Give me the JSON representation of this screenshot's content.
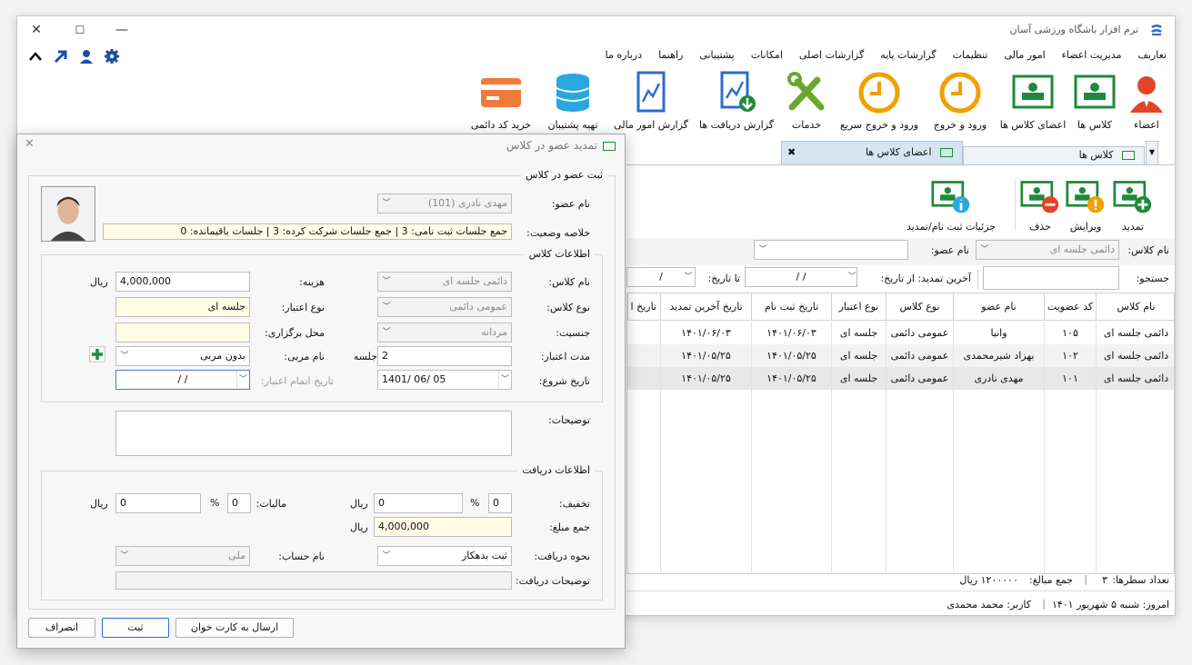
{
  "app": {
    "title": "نرم افزار باشگاه ورزشی آسان"
  },
  "window": {
    "minimize": "—",
    "maximize": "☐",
    "close": "✕"
  },
  "menu": [
    "تعاریف",
    "مدیریت اعضاء",
    "امور مالی",
    "تنظیمات",
    "گزارشات پایه",
    "گزارشات اصلی",
    "امکانات",
    "پشتیبانی",
    "راهنما",
    "درباره ما"
  ],
  "quick_icons": [
    "gear-icon",
    "user-icon",
    "arrow-up-right-icon",
    "chevron-up-icon"
  ],
  "ribbon": [
    "اعضاء",
    "کلاس ها",
    "اعضای کلاس ها",
    "ورود و خروج",
    "ورود و خروج سریع",
    "خدمات",
    "گزارش دریافت ها",
    "گزارش امور مالی",
    "تهیه پشتیبان",
    "خرید کد دائمی"
  ],
  "tabs": {
    "tab1": "کلاس ها",
    "tab2": "اعضای کلاس ها",
    "close": "✖",
    "menu": "▼"
  },
  "toolbar": {
    "renew": "تمدید",
    "edit": "ویرایش",
    "delete": "حذف",
    "details": "جزئیات ثبت نام/تمدید"
  },
  "filters": {
    "class_label": "نام کلاس:",
    "class_value": "دائمی جلسه ای",
    "member_label": "نام عضو:",
    "member_value": "",
    "search_label": "جستجو:",
    "last_renew_label": "آخرین تمدید: از تاریخ:",
    "from_date": "/     /",
    "to_label": "تا تاریخ:",
    "to_date": "/"
  },
  "grid": {
    "headers": [
      "نام کلاس",
      "کد عضویت",
      "نام عضو",
      "نوع کلاس",
      "نوع اعتبار",
      "تاریخ ثبت نام",
      "تاریخ آخرین تمدید",
      "تاریخ ا"
    ],
    "rows": [
      [
        "دائمی جلسه ای",
        "۱۰۵",
        "وانیا",
        "عمومی دائمی",
        "جلسه ای",
        "۱۴۰۱/۰۶/۰۳",
        "۱۴۰۱/۰۶/۰۳"
      ],
      [
        "دائمی جلسه ای",
        "۱۰۲",
        "بهزاد شیرمحمدی",
        "عمومی دائمی",
        "جلسه ای",
        "۱۴۰۱/۰۵/۲۵",
        "۱۴۰۱/۰۵/۲۵"
      ],
      [
        "دائمی جلسه ای",
        "۱۰۱",
        "مهدی نادری",
        "عمومی دائمی",
        "جلسه ای",
        "۱۴۰۱/۰۵/۲۵",
        "۱۴۰۱/۰۵/۲۵"
      ]
    ]
  },
  "status": {
    "rows_label": "تعداد سطرها:",
    "rows_count": "۳",
    "sum_label": "جمع مبالغ:",
    "sum_value": "۱۲۰۰۰۰۰ ریال",
    "today": "امروز: شنبه ۵ شهریور ۱۴۰۱",
    "user": "کاربر: محمد محمدی",
    "sep": "|"
  },
  "dialog": {
    "title": "تمدید عضو در کلاس",
    "close": "✕",
    "group_member": "ثبت عضو در کلاس",
    "member_label": "نام عضو:",
    "member_value": "مهدی نادری (101)",
    "summary_label": "خلاصه وضعیت:",
    "summary_value": "جمع جلسات ثبت نامی: 3  |  جمع جلسات شرکت کرده: 3  |  جلسات باقیمانده: 0",
    "group_class": "اطلاعات کلاس",
    "class_name_label": "نام کلاس:",
    "class_name_value": "دائمی جلسه ای",
    "fee_label": "هزینه:",
    "fee_value": "4,000,000",
    "rial": "ریال",
    "class_type_label": "نوع کلاس:",
    "class_type_value": "عمومی دائمی",
    "credit_type_label": "نوع اعتبار:",
    "credit_type_value": "جلسه ای",
    "gender_label": "جنسیت:",
    "gender_value": "مردانه",
    "venue_label": "محل برگزاری:",
    "venue_value": "",
    "validity_label": "مدت اعتبار:",
    "validity_value": "2",
    "session_unit": "جلسه",
    "coach_label": "نام مربی:",
    "coach_value": "بدون مربی",
    "start_label": "تاریخ شروع:",
    "start_value": "1401/ 06/ 05",
    "end_label": "تاریخ اتمام اعتبار:",
    "end_value": "/     /",
    "notes_label": "توضیحات:",
    "notes_value": "",
    "group_payment": "اطلاعات دریافت",
    "discount_label": "تخفیف:",
    "discount_pct": "0",
    "discount_amount": "0",
    "pct": "%",
    "tax_label": "مالیات:",
    "tax_pct": "0",
    "tax_amount": "0",
    "total_label": "جمع مبلغ:",
    "total_value": "4,000,000",
    "pay_method_label": "نحوه دریافت:",
    "pay_method_value": "ثبت بدهکار",
    "account_label": "نام حساب:",
    "account_value": "ملی",
    "pay_notes_label": "توضیحات دریافت:",
    "pay_notes_value": "",
    "btn_send": "ارسال به کارت خوان",
    "btn_save": "ثبت",
    "btn_cancel": "انصراف"
  },
  "colors": {
    "accent_green": "#1f8a3a",
    "accent_blue": "#2d6bd0",
    "accent_orange": "#f0a000",
    "accent_red": "#e2442a",
    "highlight": "#fffde6"
  }
}
